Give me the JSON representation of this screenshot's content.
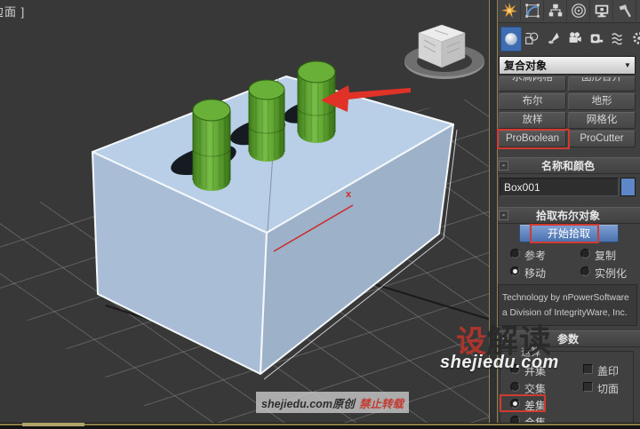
{
  "colors": {
    "viewport_bg": "#383838",
    "panel_bg": "#404040",
    "annotation_red": "#d03a2f",
    "box_top_face": "#b9cfe7",
    "box_left_face": "#a9bed6",
    "box_right_face": "#9db1c9",
    "cylinder_green": "#6ab03a",
    "pick_button_blue": "#4d76b2",
    "name_swatch_blue": "#5d87c8",
    "selected_category_blue": "#3e6db2",
    "viewport_border_olive": "#8a7f4a"
  },
  "viewport": {
    "label": "边面 ]",
    "annotation_x_label": "x",
    "watermark_center": {
      "char_red": "设",
      "chars_dark": "解读",
      "site": "shejiedu.com"
    },
    "watermark_bottom": {
      "site_text": "shejiedu.com原创",
      "warning_text": "禁止转载"
    }
  },
  "panel": {
    "tab_icons": [
      "create",
      "modify",
      "hierarchy",
      "motion",
      "display",
      "utilities"
    ],
    "category_icons": [
      "geometry",
      "shapes",
      "lights",
      "cameras",
      "helpers",
      "space-warps",
      "systems"
    ],
    "category_selected": "geometry",
    "dropdown": {
      "value": "复合对象",
      "arrow_glyph": "▼"
    },
    "object_buttons": {
      "row1": [
        "水滴网格",
        "图形合并"
      ],
      "row2": [
        "布尔",
        "地形"
      ],
      "row3": [
        "放样",
        "网格化"
      ],
      "row4": [
        "ProBoolean",
        "ProCutter"
      ]
    },
    "name_color": {
      "collapse_glyph": "-",
      "title": "名称和颜色",
      "name_value": "Box001"
    },
    "pick_rollout": {
      "collapse_glyph": "-",
      "title": "拾取布尔对象",
      "start_pick_button": "开始拾取",
      "radio_reference": "参考",
      "radio_copy": "复制",
      "radio_move": "移动",
      "radio_instance": "实例化",
      "selected_radio": "移动",
      "info_line1": "Technology by nPowerSoftware",
      "info_line2": "a Division of IntegrityWare, Inc."
    },
    "params_rollout": {
      "collapse_glyph": "-",
      "title": "参数",
      "group_label": "运算",
      "op_union": "并集",
      "op_intersect": "交集",
      "op_subtract": "差集",
      "op_merge": "合集",
      "selected_operation": "差集",
      "check_imprint": "盖印",
      "check_cookie": "切面"
    }
  }
}
